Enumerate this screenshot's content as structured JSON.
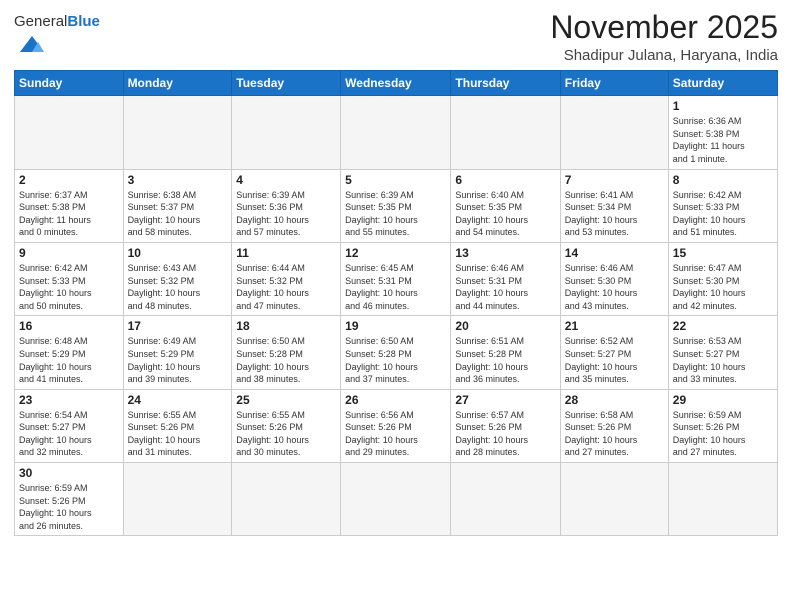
{
  "logo": {
    "text_general": "General",
    "text_blue": "Blue"
  },
  "title": "November 2025",
  "subtitle": "Shadipur Julana, Haryana, India",
  "weekdays": [
    "Sunday",
    "Monday",
    "Tuesday",
    "Wednesday",
    "Thursday",
    "Friday",
    "Saturday"
  ],
  "weeks": [
    [
      {
        "day": "",
        "info": ""
      },
      {
        "day": "",
        "info": ""
      },
      {
        "day": "",
        "info": ""
      },
      {
        "day": "",
        "info": ""
      },
      {
        "day": "",
        "info": ""
      },
      {
        "day": "",
        "info": ""
      },
      {
        "day": "1",
        "info": "Sunrise: 6:36 AM\nSunset: 5:38 PM\nDaylight: 11 hours\nand 1 minute."
      }
    ],
    [
      {
        "day": "2",
        "info": "Sunrise: 6:37 AM\nSunset: 5:38 PM\nDaylight: 11 hours\nand 0 minutes."
      },
      {
        "day": "3",
        "info": "Sunrise: 6:38 AM\nSunset: 5:37 PM\nDaylight: 10 hours\nand 58 minutes."
      },
      {
        "day": "4",
        "info": "Sunrise: 6:39 AM\nSunset: 5:36 PM\nDaylight: 10 hours\nand 57 minutes."
      },
      {
        "day": "5",
        "info": "Sunrise: 6:39 AM\nSunset: 5:35 PM\nDaylight: 10 hours\nand 55 minutes."
      },
      {
        "day": "6",
        "info": "Sunrise: 6:40 AM\nSunset: 5:35 PM\nDaylight: 10 hours\nand 54 minutes."
      },
      {
        "day": "7",
        "info": "Sunrise: 6:41 AM\nSunset: 5:34 PM\nDaylight: 10 hours\nand 53 minutes."
      },
      {
        "day": "8",
        "info": "Sunrise: 6:42 AM\nSunset: 5:33 PM\nDaylight: 10 hours\nand 51 minutes."
      }
    ],
    [
      {
        "day": "9",
        "info": "Sunrise: 6:42 AM\nSunset: 5:33 PM\nDaylight: 10 hours\nand 50 minutes."
      },
      {
        "day": "10",
        "info": "Sunrise: 6:43 AM\nSunset: 5:32 PM\nDaylight: 10 hours\nand 48 minutes."
      },
      {
        "day": "11",
        "info": "Sunrise: 6:44 AM\nSunset: 5:32 PM\nDaylight: 10 hours\nand 47 minutes."
      },
      {
        "day": "12",
        "info": "Sunrise: 6:45 AM\nSunset: 5:31 PM\nDaylight: 10 hours\nand 46 minutes."
      },
      {
        "day": "13",
        "info": "Sunrise: 6:46 AM\nSunset: 5:31 PM\nDaylight: 10 hours\nand 44 minutes."
      },
      {
        "day": "14",
        "info": "Sunrise: 6:46 AM\nSunset: 5:30 PM\nDaylight: 10 hours\nand 43 minutes."
      },
      {
        "day": "15",
        "info": "Sunrise: 6:47 AM\nSunset: 5:30 PM\nDaylight: 10 hours\nand 42 minutes."
      }
    ],
    [
      {
        "day": "16",
        "info": "Sunrise: 6:48 AM\nSunset: 5:29 PM\nDaylight: 10 hours\nand 41 minutes."
      },
      {
        "day": "17",
        "info": "Sunrise: 6:49 AM\nSunset: 5:29 PM\nDaylight: 10 hours\nand 39 minutes."
      },
      {
        "day": "18",
        "info": "Sunrise: 6:50 AM\nSunset: 5:28 PM\nDaylight: 10 hours\nand 38 minutes."
      },
      {
        "day": "19",
        "info": "Sunrise: 6:50 AM\nSunset: 5:28 PM\nDaylight: 10 hours\nand 37 minutes."
      },
      {
        "day": "20",
        "info": "Sunrise: 6:51 AM\nSunset: 5:28 PM\nDaylight: 10 hours\nand 36 minutes."
      },
      {
        "day": "21",
        "info": "Sunrise: 6:52 AM\nSunset: 5:27 PM\nDaylight: 10 hours\nand 35 minutes."
      },
      {
        "day": "22",
        "info": "Sunrise: 6:53 AM\nSunset: 5:27 PM\nDaylight: 10 hours\nand 33 minutes."
      }
    ],
    [
      {
        "day": "23",
        "info": "Sunrise: 6:54 AM\nSunset: 5:27 PM\nDaylight: 10 hours\nand 32 minutes."
      },
      {
        "day": "24",
        "info": "Sunrise: 6:55 AM\nSunset: 5:26 PM\nDaylight: 10 hours\nand 31 minutes."
      },
      {
        "day": "25",
        "info": "Sunrise: 6:55 AM\nSunset: 5:26 PM\nDaylight: 10 hours\nand 30 minutes."
      },
      {
        "day": "26",
        "info": "Sunrise: 6:56 AM\nSunset: 5:26 PM\nDaylight: 10 hours\nand 29 minutes."
      },
      {
        "day": "27",
        "info": "Sunrise: 6:57 AM\nSunset: 5:26 PM\nDaylight: 10 hours\nand 28 minutes."
      },
      {
        "day": "28",
        "info": "Sunrise: 6:58 AM\nSunset: 5:26 PM\nDaylight: 10 hours\nand 27 minutes."
      },
      {
        "day": "29",
        "info": "Sunrise: 6:59 AM\nSunset: 5:26 PM\nDaylight: 10 hours\nand 27 minutes."
      }
    ],
    [
      {
        "day": "30",
        "info": "Sunrise: 6:59 AM\nSunset: 5:26 PM\nDaylight: 10 hours\nand 26 minutes."
      },
      {
        "day": "",
        "info": ""
      },
      {
        "day": "",
        "info": ""
      },
      {
        "day": "",
        "info": ""
      },
      {
        "day": "",
        "info": ""
      },
      {
        "day": "",
        "info": ""
      },
      {
        "day": "",
        "info": ""
      }
    ]
  ]
}
